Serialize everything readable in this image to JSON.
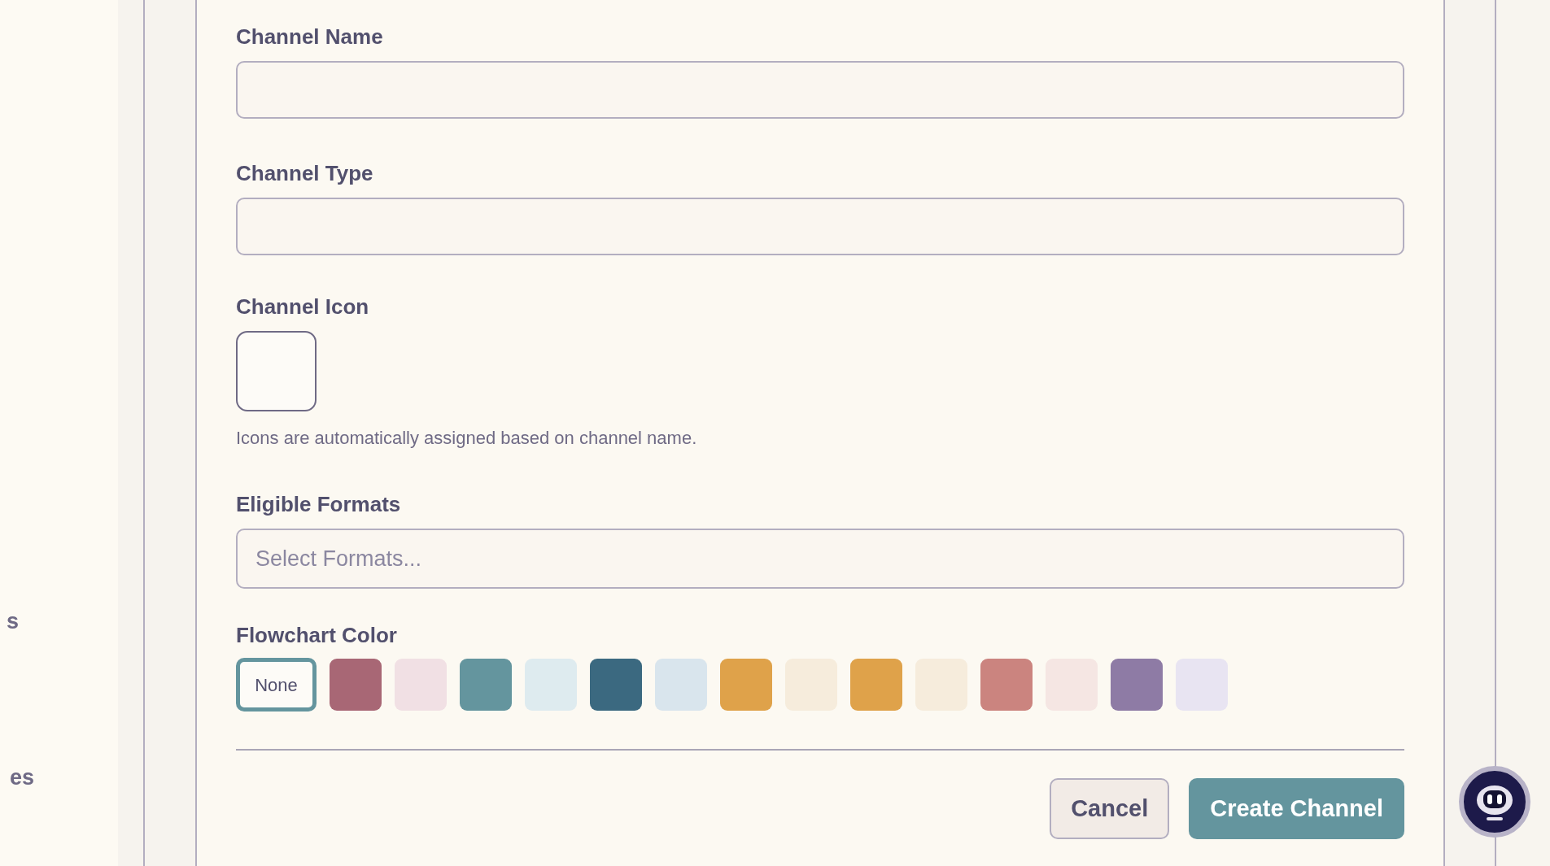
{
  "sidebar": {
    "items": [
      {
        "label": "s"
      },
      {
        "label": "es"
      }
    ]
  },
  "form": {
    "fields": [
      {
        "kind": "text",
        "label": "Channel Name"
      },
      {
        "kind": "text",
        "label": "Channel Type"
      },
      {
        "kind": "icon",
        "label": "Channel Icon",
        "hint": "Icons are automatically assigned based on channel name."
      },
      {
        "kind": "select",
        "label": "Eligible Formats",
        "placeholder": "Select Formats..."
      }
    ],
    "flowchart_color": {
      "label": "Flowchart Color",
      "swatches": [
        {
          "kind": "none",
          "label": "None",
          "selected": true
        },
        {
          "kind": "color",
          "color": "#a86775",
          "selected": false
        },
        {
          "kind": "color",
          "color": "#f1e0e4",
          "selected": false
        },
        {
          "kind": "color",
          "color": "#64959e",
          "selected": false
        },
        {
          "kind": "color",
          "color": "#deebef",
          "selected": false
        },
        {
          "kind": "color",
          "color": "#3b6980",
          "selected": false
        },
        {
          "kind": "color",
          "color": "#d9e5ed",
          "selected": false
        },
        {
          "kind": "color",
          "color": "#dfa24a",
          "selected": false
        },
        {
          "kind": "color",
          "color": "#f6ecdc",
          "selected": false
        },
        {
          "kind": "color",
          "color": "#dfa24a",
          "selected": false
        },
        {
          "kind": "color",
          "color": "#f6ecdc",
          "selected": false
        },
        {
          "kind": "color",
          "color": "#cb847f",
          "selected": false
        },
        {
          "kind": "color",
          "color": "#f5e6e3",
          "selected": false
        },
        {
          "kind": "color",
          "color": "#8e7ba5",
          "selected": false
        },
        {
          "kind": "color",
          "color": "#e8e4f2",
          "selected": false
        }
      ]
    },
    "buttons": [
      {
        "kind": "secondary",
        "label": "Cancel"
      },
      {
        "kind": "primary",
        "label": "Create Channel"
      }
    ]
  }
}
